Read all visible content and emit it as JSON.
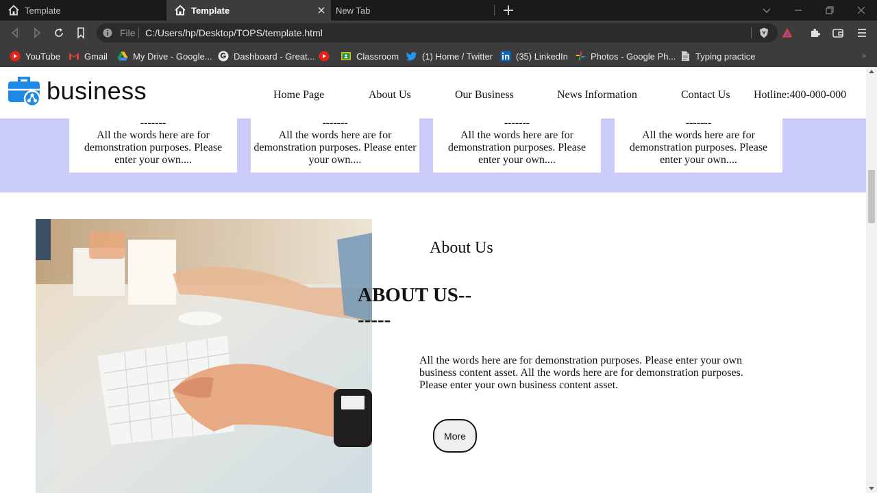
{
  "browser": {
    "tabs": [
      {
        "title": "Template",
        "active": false
      },
      {
        "title": "Template",
        "active": true
      },
      {
        "title": "New Tab",
        "active": false
      }
    ],
    "address": {
      "scheme_label": "File",
      "url": "C:/Users/hp/Desktop/TOPS/template.html"
    },
    "bookmarks": [
      {
        "label": "YouTube",
        "icon": "youtube-icon"
      },
      {
        "label": "Gmail",
        "icon": "gmail-icon"
      },
      {
        "label": "My Drive - Google...",
        "icon": "drive-icon"
      },
      {
        "label": "Dashboard - Great...",
        "icon": "google-icon"
      },
      {
        "label": "",
        "icon": "youtube-icon"
      },
      {
        "label": "Classroom",
        "icon": "classroom-icon"
      },
      {
        "label": "(1) Home / Twitter",
        "icon": "twitter-icon"
      },
      {
        "label": "(35) LinkedIn",
        "icon": "linkedin-icon"
      },
      {
        "label": "Photos - Google Ph...",
        "icon": "photos-icon"
      },
      {
        "label": "Typing practice",
        "icon": "typing-icon"
      }
    ]
  },
  "site": {
    "logo_text": "business",
    "nav": [
      "Home Page",
      "About Us",
      "Our Business",
      "News Information",
      "Contact Us"
    ],
    "hotline": "Hotline:400-000-000"
  },
  "features": {
    "cards": [
      {
        "dash": "-------",
        "text": "All the words here are for demonstration purposes. Please enter your own...."
      },
      {
        "dash": "-------",
        "text": "All the words here are for demonstration purposes. Please enter your own...."
      },
      {
        "dash": "-------",
        "text": "All the words here are for demonstration purposes. Please enter your own...."
      },
      {
        "dash": "-------",
        "text": "All the words here are for demonstration purposes. Please enter your own...."
      }
    ]
  },
  "about": {
    "subtitle": "About Us",
    "heading_line1": "ABOUT US--",
    "heading_line2": "-----",
    "paragraph": "All the words here are for demonstration purposes. Please enter your own business content asset. All the words here are for demonstration purposes. Please enter your own business content asset.",
    "button_label": "More"
  },
  "colors": {
    "features_band": "#ccccfb",
    "logo_blue": "#1e88e5",
    "chrome_dark": "#1a1a1a",
    "chrome_mid": "#3c3c3c"
  }
}
